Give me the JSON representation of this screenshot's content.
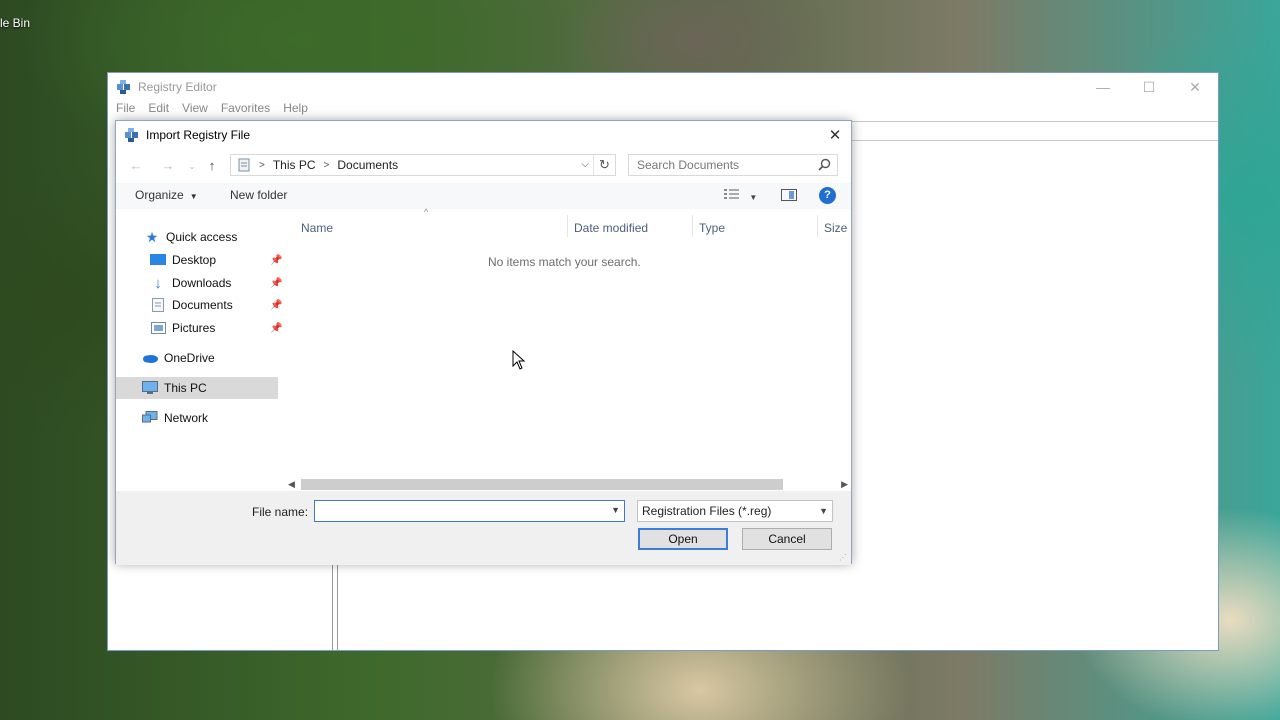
{
  "desktop": {
    "icon_label": "le Bin"
  },
  "registry_editor": {
    "title": "Registry Editor",
    "menu": [
      "File",
      "Edit",
      "View",
      "Favorites",
      "Help"
    ],
    "controls": {
      "minimize": "—",
      "maximize": "☐",
      "close": "✕"
    }
  },
  "dialog": {
    "title": "Import Registry File",
    "close": "✕",
    "nav": {
      "back": "←",
      "forward": "→",
      "recent": "⌄",
      "up": "↑"
    },
    "breadcrumb": [
      "This PC",
      "Documents"
    ],
    "search_placeholder": "Search Documents",
    "toolbar": {
      "organize": "Organize",
      "new_folder": "New folder",
      "help": "?"
    },
    "nav_pane": {
      "quick_access": "Quick access",
      "items": [
        "Desktop",
        "Downloads",
        "Documents",
        "Pictures"
      ],
      "onedrive": "OneDrive",
      "this_pc": "This PC",
      "network": "Network"
    },
    "columns": [
      "Name",
      "Date modified",
      "Type",
      "Size"
    ],
    "empty_message": "No items match your search.",
    "file_name_label": "File name:",
    "file_name_value": "",
    "file_type": "Registration Files (*.reg)",
    "open_button": "Open",
    "cancel_button": "Cancel"
  }
}
